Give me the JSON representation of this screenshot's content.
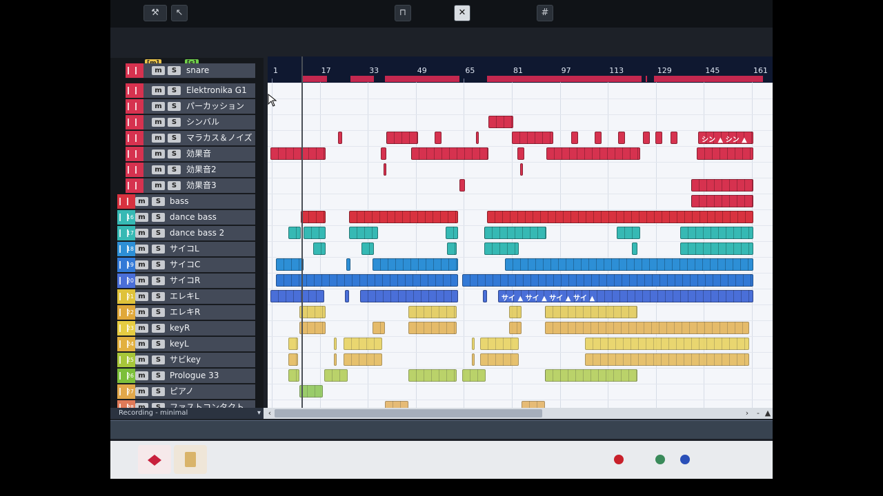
{
  "toolbar": {
    "buttons": [
      {
        "icon": "tools-icon",
        "glyph": "⚒"
      },
      {
        "icon": "pointer-icon",
        "glyph": "↖"
      },
      {
        "icon": "snap-icon",
        "glyph": "⊓"
      },
      {
        "icon": "close-tool-icon",
        "glyph": "✕"
      },
      {
        "icon": "grid-icon",
        "glyph": "#"
      }
    ]
  },
  "tracklist": {
    "header_badges": [
      "[m]",
      "[s]"
    ],
    "status": "Recording - minimal",
    "tracks": [
      {
        "num": "",
        "name": "snare",
        "color": "#d6324f"
      },
      {
        "num": "",
        "name": "Elektronika G1",
        "color": "#d6324f"
      },
      {
        "num": "",
        "name": "パーカッション",
        "color": "#d6324f"
      },
      {
        "num": "",
        "name": "シンバル",
        "color": "#d6324f"
      },
      {
        "num": "",
        "name": "マラカス＆ノイズ",
        "color": "#d6324f"
      },
      {
        "num": "",
        "name": "効果音",
        "color": "#d6324f"
      },
      {
        "num": "",
        "name": "効果音2",
        "color": "#d6324f"
      },
      {
        "num": "",
        "name": "効果音3",
        "color": "#d6324f"
      },
      {
        "num": "",
        "name": "bass",
        "color": "#d8323f"
      },
      {
        "num": "16",
        "name": "dance bass",
        "color": "#36b9b4"
      },
      {
        "num": "17",
        "name": "dance bass 2",
        "color": "#36b9b4"
      },
      {
        "num": "18",
        "name": "サイコL",
        "color": "#2d8fd6"
      },
      {
        "num": "19",
        "name": "サイコC",
        "color": "#3279d6"
      },
      {
        "num": "20",
        "name": "サイコR",
        "color": "#4a6fd8"
      },
      {
        "num": "21",
        "name": "エレキL",
        "color": "#dfc23a"
      },
      {
        "num": "22",
        "name": "エレキR",
        "color": "#e0a83a"
      },
      {
        "num": "23",
        "name": "keyR",
        "color": "#e6cc42"
      },
      {
        "num": "24",
        "name": "keyL",
        "color": "#e2b040"
      },
      {
        "num": "25",
        "name": "サビkey",
        "color": "#a7c63a"
      },
      {
        "num": "26",
        "name": "Prologue 33",
        "color": "#7cbf3a"
      },
      {
        "num": "27",
        "name": "ピアノ",
        "color": "#e2a84a"
      },
      {
        "num": "28",
        "name": "ファストコンタクト",
        "color": "#e07a58"
      }
    ]
  },
  "ruler": {
    "bars": [
      "1",
      "17",
      "33",
      "49",
      "65",
      "81",
      "97",
      "113",
      "129",
      "145",
      "161"
    ]
  },
  "clip_labels": {
    "cymbal_end": "シン ▲ シン ▲",
    "saiko_end": "サイ ▲ サイ ▲ サイ ▲ サイ ▲"
  },
  "taskbar": {
    "apps": [
      "cubase-app-icon",
      "file-app-icon"
    ],
    "tray": [
      "record-icon",
      "network-icon",
      "help-icon"
    ]
  }
}
